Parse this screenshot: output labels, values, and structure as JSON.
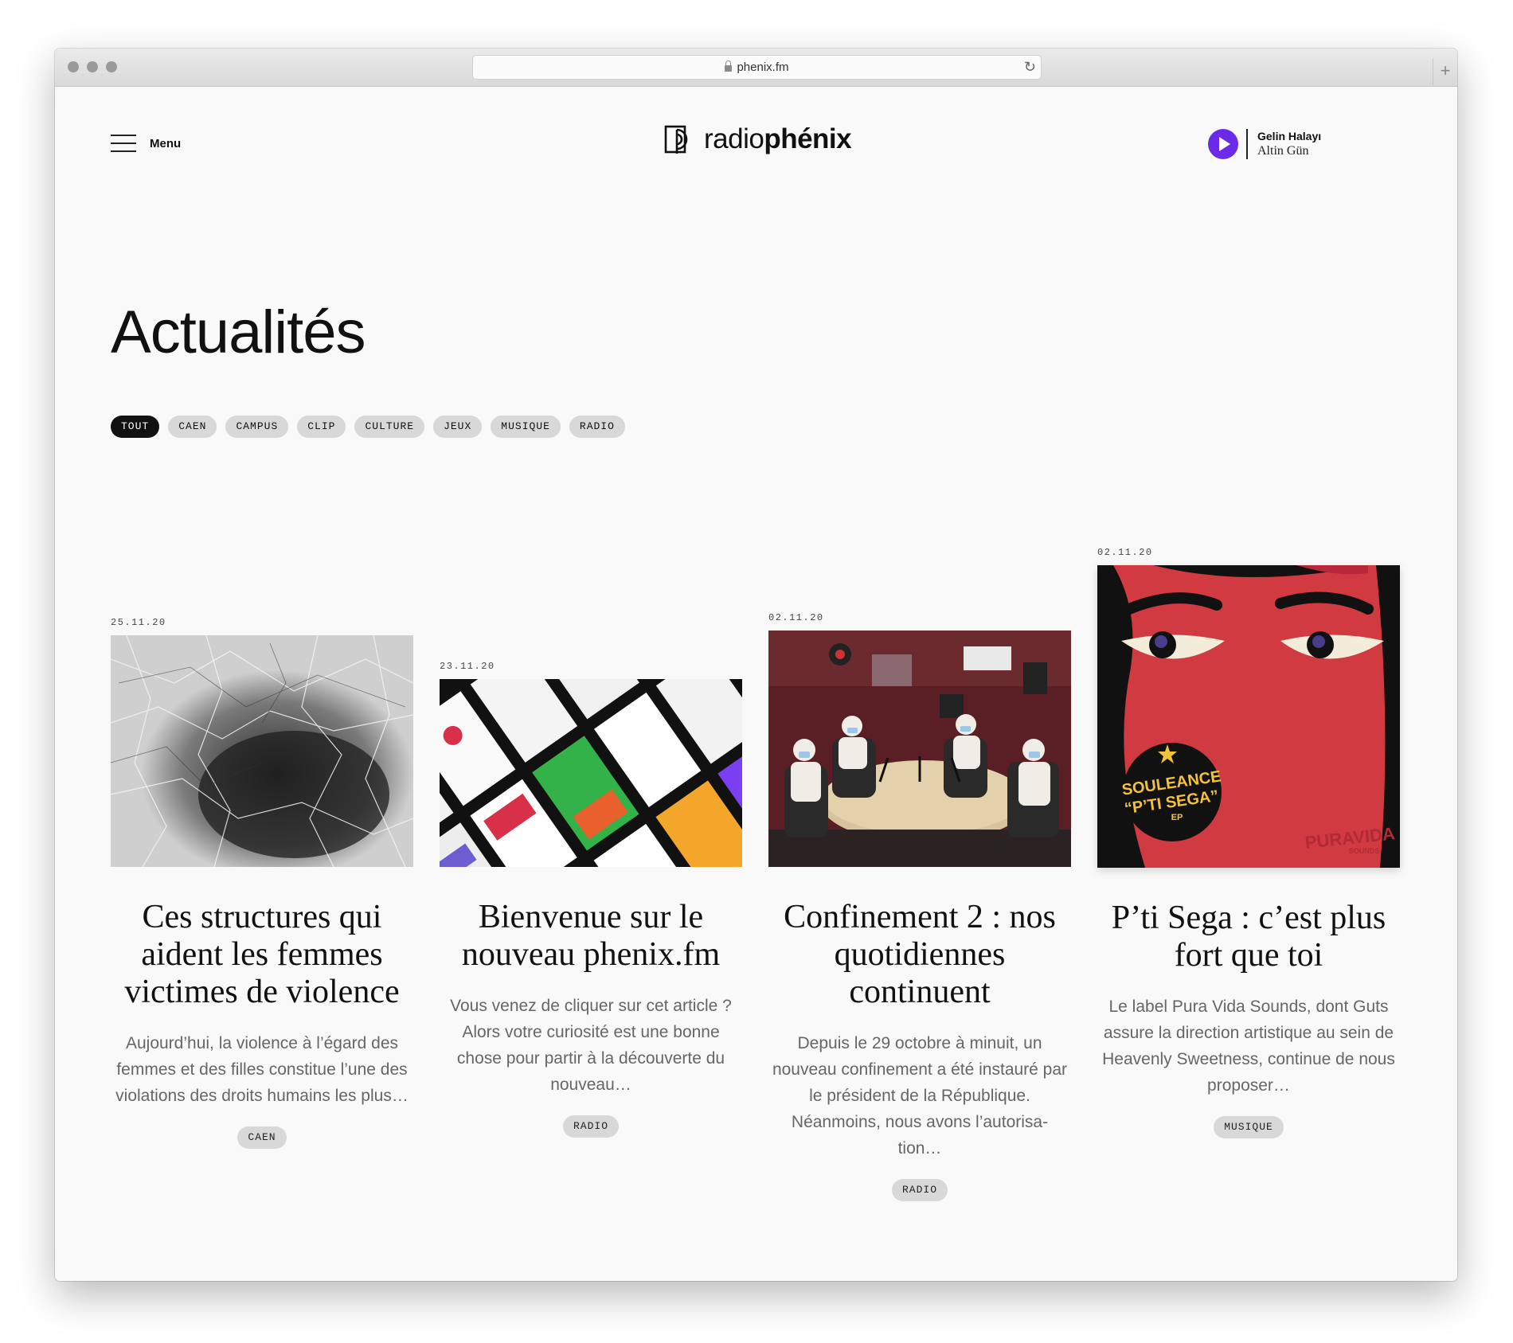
{
  "browser": {
    "url": "phenix.fm"
  },
  "header": {
    "menu_label": "Menu",
    "logo_prefix": "radio",
    "logo_suffix": "phénix",
    "now_playing": {
      "title": "Gelin Halayı",
      "artist": "Altin Gün"
    }
  },
  "page": {
    "title": "Actualités"
  },
  "filters": [
    "TOUT",
    "CAEN",
    "CAMPUS",
    "CLIP",
    "CULTURE",
    "JEUX",
    "MUSIQUE",
    "RADIO"
  ],
  "articles": [
    {
      "date": "25.11.20",
      "title": "Ces structures qui aident les femmes victimes de violence",
      "excerpt": "Aujourd’hui, la violence à l’égard des femmes et des filles constitue l’une des violations des droits humains les plus…",
      "tag": "CAEN"
    },
    {
      "date": "23.11.20",
      "title": "Bienvenue sur le nouveau phenix.fm",
      "excerpt": "Vous venez de cliquer sur cet article ? Alors votre curiosité est une bonne chose pour partir à la découverte du nouveau…",
      "tag": "RADIO"
    },
    {
      "date": "02.11.20",
      "title": "Confinement 2 : nos quotidiennes continuent",
      "excerpt": "Depuis le 29 octobre à minuit, un nouveau confinement a été instauré par le président de la République. Néanmoins, nous avons l’autorisa- tion…",
      "tag": "RADIO"
    },
    {
      "date": "02.11.20",
      "title": "P’ti Sega : c’est plus fort que toi",
      "excerpt": "Le label Pura Vida Sounds, dont Guts assure la direction artistique au sein de Heavenly Sweetness, continue de nous proposer…",
      "tag": "MUSIQUE",
      "cover_text": {
        "line1": "SOULEANCE",
        "line2": "“P’TI SEGA”",
        "line3": "EP",
        "label": "PURAVIDA",
        "label_sub": "SOUNDS"
      }
    }
  ],
  "colors": {
    "accent": "#6a2ae8",
    "chip_bg": "#d8d8d8",
    "chip_active_bg": "#111111"
  }
}
